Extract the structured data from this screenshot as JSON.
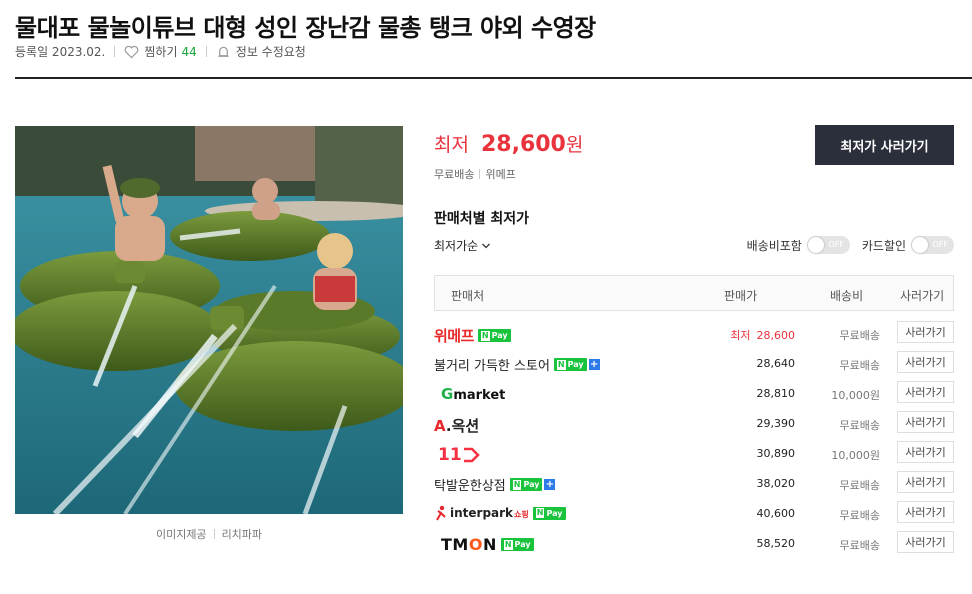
{
  "product": {
    "title": "물대포 물놀이튜브 대형 성인 장난감 물총 탱크 야외 수영장",
    "registered": "등록일 2023.02.",
    "wish_label": "찜하기",
    "wish_count": "44",
    "report_label": "정보 수정요청"
  },
  "image": {
    "provider_label": "이미지제공",
    "provider_name": "리치파파"
  },
  "summary": {
    "lowest_label": "최저",
    "lowest_price": "28,600",
    "currency": "원",
    "shipping": "무료배송",
    "store": "위메프",
    "buy_button": "최저가 사러가기"
  },
  "sellers_section": {
    "title": "판매처별 최저가",
    "sort_label": "최저가순",
    "toggle_shipping_label": "배송비포함",
    "toggle_card_label": "카드할인",
    "toggle_off_text": "OFF",
    "columns": [
      "판매처",
      "판매가",
      "배송비",
      "사러가기"
    ]
  },
  "sellers": [
    {
      "store": "위메프",
      "npay": "Pay",
      "price_label": "최저",
      "price": "28,600",
      "shipping": "무료배송",
      "button": "사러가기"
    },
    {
      "store": "불거리 가득한 스토어",
      "npay": "Pay",
      "plus": "+",
      "price": "28,640",
      "shipping": "무료배송",
      "button": "사러가기"
    },
    {
      "store": "market",
      "logo_prefix": "G",
      "price": "28,810",
      "shipping": "10,000원",
      "button": "사러가기"
    },
    {
      "store": ".옥션",
      "logo_prefix": "A",
      "price": "29,390",
      "shipping": "무료배송",
      "button": "사러가기"
    },
    {
      "store": "11",
      "price": "30,890",
      "shipping": "10,000원",
      "button": "사러가기"
    },
    {
      "store": "탁발운한상점",
      "npay": "Pay",
      "plus": "+",
      "price": "38,020",
      "shipping": "무료배송",
      "button": "사러가기"
    },
    {
      "store": "interpark",
      "store_suffix": "쇼핑",
      "npay": "Pay",
      "price": "40,600",
      "shipping": "무료배송",
      "button": "사러가기"
    },
    {
      "store": "TM",
      "store_o": "O",
      "store_n": "N",
      "npay": "Pay",
      "price": "58,520",
      "shipping": "무료배송",
      "button": "사러가기"
    }
  ],
  "npay_letter": "N",
  "colors": {
    "accent_red": "#e8333d",
    "npay_green": "#19c33c",
    "button_dark": "#2b2f3b"
  },
  "icons": {
    "wish": "heart-icon",
    "report": "bell-icon",
    "sort": "chevron-down-icon"
  }
}
